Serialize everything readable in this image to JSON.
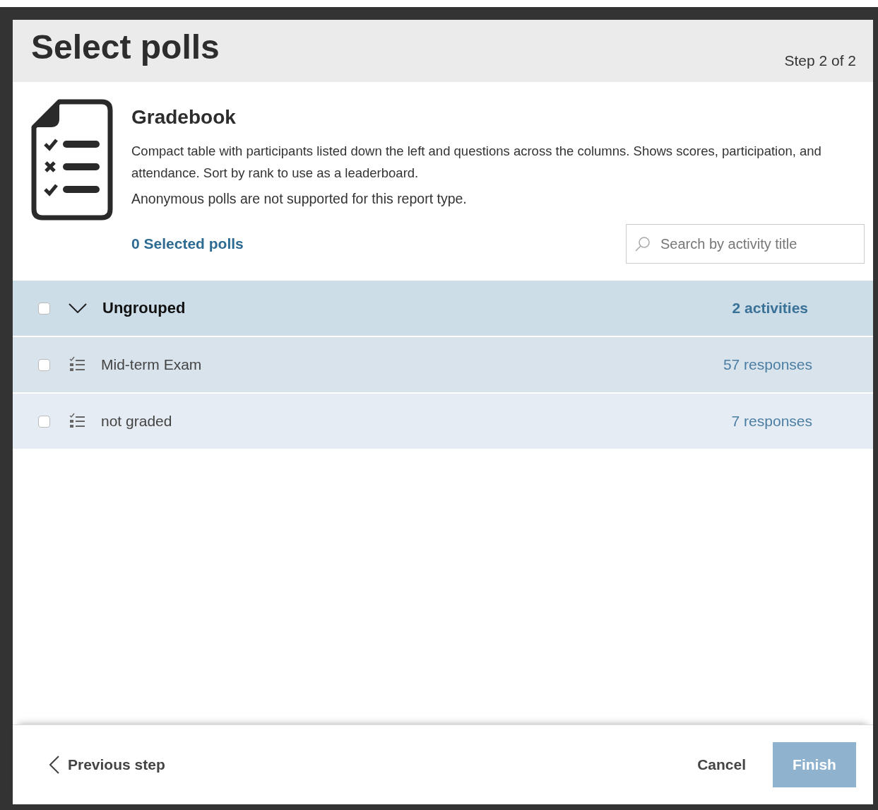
{
  "dialog": {
    "title": "Select polls",
    "step": "Step 2 of 2"
  },
  "report": {
    "title": "Gradebook",
    "description": "Compact table with participants listed down the left and questions across the columns. Shows scores, participation, and attendance. Sort by rank to use as a leaderboard.",
    "note": "Anonymous polls are not supported for this report type."
  },
  "selected_count": "0 Selected polls",
  "search": {
    "placeholder": "Search by activity title"
  },
  "groups": [
    {
      "label": "Ungrouped",
      "count": "2 activities",
      "checked": false,
      "expanded": true,
      "items": [
        {
          "title": "Mid-term Exam",
          "responses": "57 responses",
          "checked": false
        },
        {
          "title": "not graded",
          "responses": "7 responses",
          "checked": false
        }
      ]
    }
  ],
  "footer": {
    "previous": "Previous step",
    "cancel": "Cancel",
    "finish": {
      "label": "Finish",
      "disabled": true
    }
  }
}
